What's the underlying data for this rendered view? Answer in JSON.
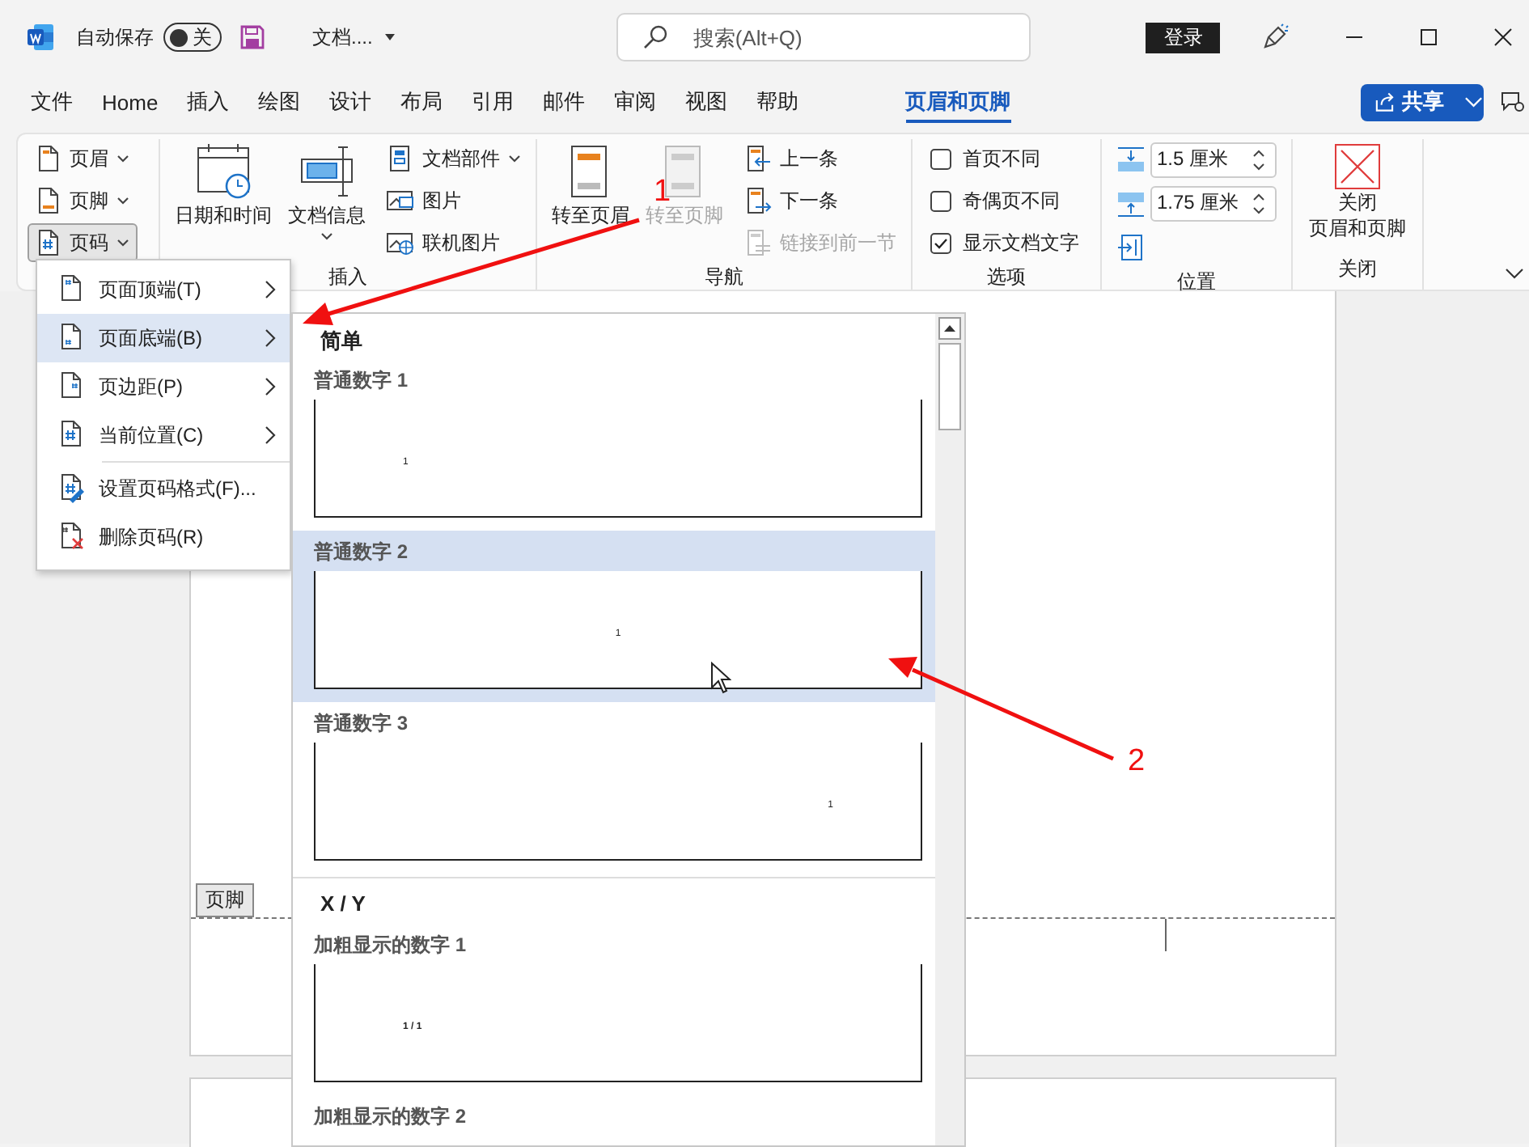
{
  "title_bar": {
    "autosave_label": "自动保存",
    "autosave_toggle": {
      "label": "关",
      "on": false
    },
    "document_name": "文档....",
    "search": {
      "placeholder": "搜索(Alt+Q)"
    },
    "sign_in_button": "登录"
  },
  "tabs": [
    {
      "label": "文件",
      "selected": false
    },
    {
      "label": "Home",
      "selected": false
    },
    {
      "label": "插入",
      "selected": false
    },
    {
      "label": "绘图",
      "selected": false
    },
    {
      "label": "设计",
      "selected": false
    },
    {
      "label": "布局",
      "selected": false
    },
    {
      "label": "引用",
      "selected": false
    },
    {
      "label": "邮件",
      "selected": false
    },
    {
      "label": "审阅",
      "selected": false
    },
    {
      "label": "视图",
      "selected": false
    },
    {
      "label": "帮助",
      "selected": false
    }
  ],
  "contextual_tabs": [
    {
      "label": "页眉和页脚",
      "selected": true
    }
  ],
  "share_button": "共享",
  "ribbon": {
    "header_footer": {
      "buttons": [
        {
          "label": "页眉",
          "expanded": false
        },
        {
          "label": "页脚",
          "expanded": false
        },
        {
          "label": "页码",
          "expanded": true
        }
      ]
    },
    "insert": {
      "label": "插入",
      "large_buttons": [
        {
          "label": "日期和时间"
        },
        {
          "label": "文档信息"
        }
      ],
      "small_buttons": [
        {
          "label": "文档部件"
        },
        {
          "label": "图片"
        },
        {
          "label": "联机图片"
        }
      ]
    },
    "navigation": {
      "label": "导航",
      "large_buttons": [
        {
          "label": "转至页眉",
          "disabled": false
        },
        {
          "label": "转至页脚",
          "disabled": true
        }
      ],
      "small_buttons": [
        {
          "label": "上一条",
          "disabled": false
        },
        {
          "label": "下一条",
          "disabled": false
        },
        {
          "label": "链接到前一节",
          "disabled": true
        }
      ]
    },
    "options": {
      "label": "选项",
      "checkboxes": [
        {
          "label": "首页不同",
          "checked": false
        },
        {
          "label": "奇偶页不同",
          "checked": false
        },
        {
          "label": "显示文档文字",
          "checked": true
        }
      ]
    },
    "position": {
      "label": "位置",
      "fields": [
        {
          "value": "1.5 厘米"
        },
        {
          "value": "1.75 厘米"
        }
      ]
    },
    "close": {
      "label": "关闭",
      "button_lines": [
        "关闭",
        "页眉和页脚"
      ]
    }
  },
  "document": {
    "footer_tag": "页脚"
  },
  "page_number_menu": {
    "items": [
      {
        "label": "页面顶端(T)",
        "kind": "submenu",
        "selected": false
      },
      {
        "label": "页面底端(B)",
        "kind": "submenu",
        "selected": true
      },
      {
        "label": "页边距(P)",
        "kind": "submenu",
        "selected": false
      },
      {
        "label": "当前位置(C)",
        "kind": "submenu",
        "selected": false
      },
      {
        "label": "设置页码格式(F)...",
        "kind": "command",
        "selected": false
      },
      {
        "label": "删除页码(R)",
        "kind": "command",
        "selected": false
      }
    ]
  },
  "gallery": {
    "sections": [
      {
        "heading": "简单",
        "items": [
          {
            "label": "普通数字 1",
            "preview": "1",
            "kind": "left",
            "selected": false
          },
          {
            "label": "普通数字 2",
            "preview": "1",
            "kind": "center",
            "selected": true
          },
          {
            "label": "普通数字 3",
            "preview": "1",
            "kind": "right",
            "selected": false
          }
        ]
      },
      {
        "heading": "X / Y",
        "items": [
          {
            "label": "加粗显示的数字 1",
            "preview": "1 / 1",
            "kind": "left",
            "selected": false
          },
          {
            "label": "加粗显示的数字 2",
            "selected": false
          }
        ]
      }
    ]
  },
  "annotations": [
    {
      "label": "1"
    },
    {
      "label": "2"
    }
  ]
}
